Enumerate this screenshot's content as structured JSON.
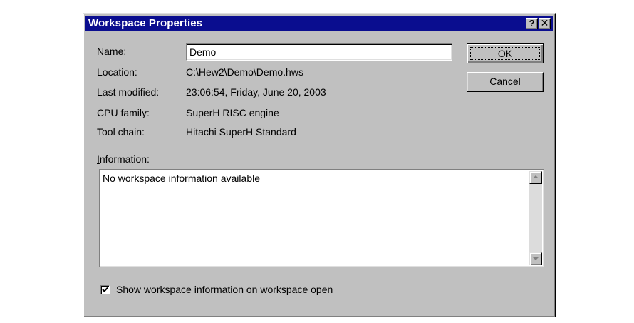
{
  "dialog": {
    "title": "Workspace Properties",
    "help_button": "?",
    "close_button": "✕"
  },
  "fields": {
    "name_label": "Name:",
    "name_value": "Demo",
    "location_label": "Location:",
    "location_value": "C:\\Hew2\\Demo\\Demo.hws",
    "last_modified_label": "Last modified:",
    "last_modified_value": "23:06:54, Friday, June 20, 2003",
    "cpu_family_label": "CPU family:",
    "cpu_family_value": "SuperH RISC engine",
    "tool_chain_label": "Tool chain:",
    "tool_chain_value": "Hitachi SuperH Standard"
  },
  "buttons": {
    "ok": "OK",
    "cancel": "Cancel"
  },
  "information": {
    "label": "Information:",
    "text": "No workspace information available"
  },
  "options": {
    "show_info_label": "Show workspace information on workspace open",
    "show_info_checked": true
  }
}
